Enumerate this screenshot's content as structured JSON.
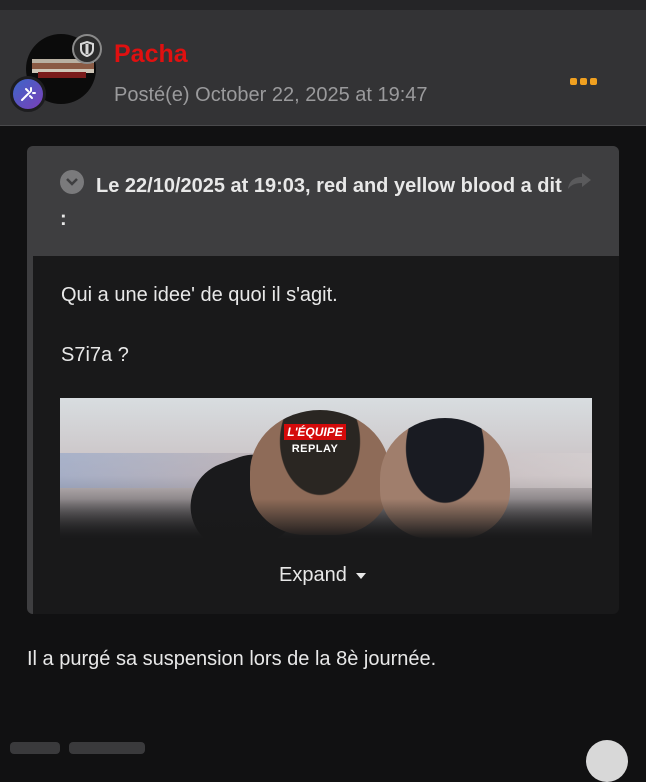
{
  "post": {
    "username": "Pacha",
    "posted": "Posté(e) October 22, 2025 at 19:47",
    "more_menu_icon": "ellipsis-icon",
    "accent_color": "#f0a020",
    "username_color": "#e01010"
  },
  "quote": {
    "title": "Le 22/10/2025 at 19:03, red and yellow blood a dit :",
    "lines": [
      "Qui a une idee' de quoi il s'agit.",
      "S7i7a ?"
    ],
    "embed": {
      "brand": "L'ÉQUIPE",
      "sub": "REPLAY"
    },
    "expand_label": "Expand"
  },
  "body": {
    "text": "Il a purgé sa suspension lors de la 8è journée."
  }
}
